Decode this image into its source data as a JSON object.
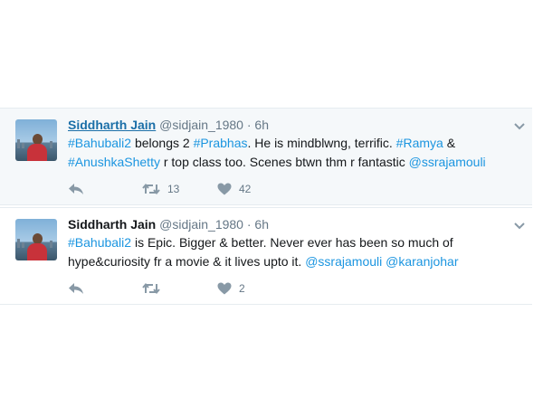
{
  "tweets": [
    {
      "name": "Siddharth Jain",
      "handle": "@sidjain_1980",
      "separator": "·",
      "time": "6h",
      "text_line1": [
        {
          "t": "#Bahubali2",
          "link": true
        },
        {
          "t": " belongs 2 ",
          "link": false
        },
        {
          "t": "#Prabhas",
          "link": true
        },
        {
          "t": ". He is mindblwng, terrific. ",
          "link": false
        },
        {
          "t": "#Ramya",
          "link": true
        },
        {
          "t": " &",
          "link": false
        }
      ],
      "text_line2": [
        {
          "t": "#AnushkaShetty",
          "link": true
        },
        {
          "t": " r top class too. Scenes btwn thm r fantastic ",
          "link": false
        },
        {
          "t": "@ssrajamouli",
          "link": true
        }
      ],
      "retweets": "13",
      "likes": "42"
    },
    {
      "name": "Siddharth Jain",
      "handle": "@sidjain_1980",
      "separator": "·",
      "time": "6h",
      "text_line1": [
        {
          "t": "#Bahubali2",
          "link": true
        },
        {
          "t": " is Epic. Bigger & better. Never ever has been so much of",
          "link": false
        }
      ],
      "text_line2": [
        {
          "t": "hype&curiosity fr a movie & it lives upto it. ",
          "link": false
        },
        {
          "t": "@ssrajamouli",
          "link": true
        },
        {
          "t": " ",
          "link": false
        },
        {
          "t": "@karanjohar",
          "link": true
        }
      ],
      "retweets": "",
      "likes": "2"
    }
  ],
  "icons": {
    "reply": "reply-icon",
    "retweet": "retweet-icon",
    "like": "heart-icon",
    "more": "chevron-down-icon"
  },
  "colors": {
    "link": "#1b95e0",
    "muted": "#657786",
    "name_link": "#1b6fa8",
    "highlight_bg": "#f5f8fa"
  }
}
